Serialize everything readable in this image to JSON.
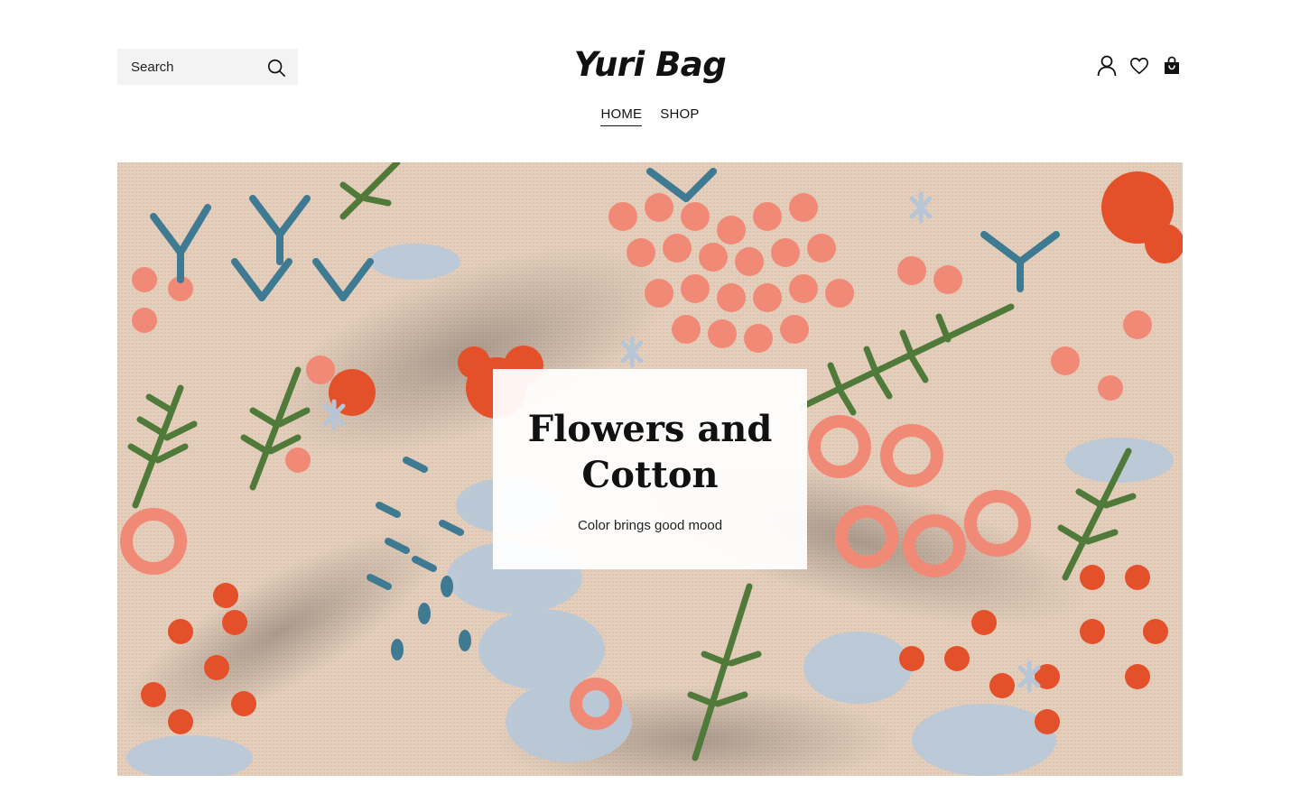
{
  "header": {
    "search": {
      "placeholder": "Search"
    },
    "logo": "Yuri Bag",
    "icons": [
      "account-icon",
      "heart-icon",
      "bag-icon"
    ]
  },
  "nav": {
    "items": [
      {
        "label": "HOME",
        "active": true
      },
      {
        "label": "SHOP",
        "active": false
      }
    ]
  },
  "hero": {
    "title": "Flowers and Cotton",
    "subtitle": "Color brings good mood",
    "image": "embroidered-floral-fabric"
  },
  "colors": {
    "text": "#111111",
    "search_bg": "#f3f3f3",
    "fabric": "#e3cdbb",
    "embroidery_pink": "#f08a76",
    "embroidery_red": "#e4502a",
    "embroidery_green": "#4f7a3a",
    "embroidery_teal": "#3f7a93",
    "embroidery_lightblue": "#b7c6d6"
  }
}
